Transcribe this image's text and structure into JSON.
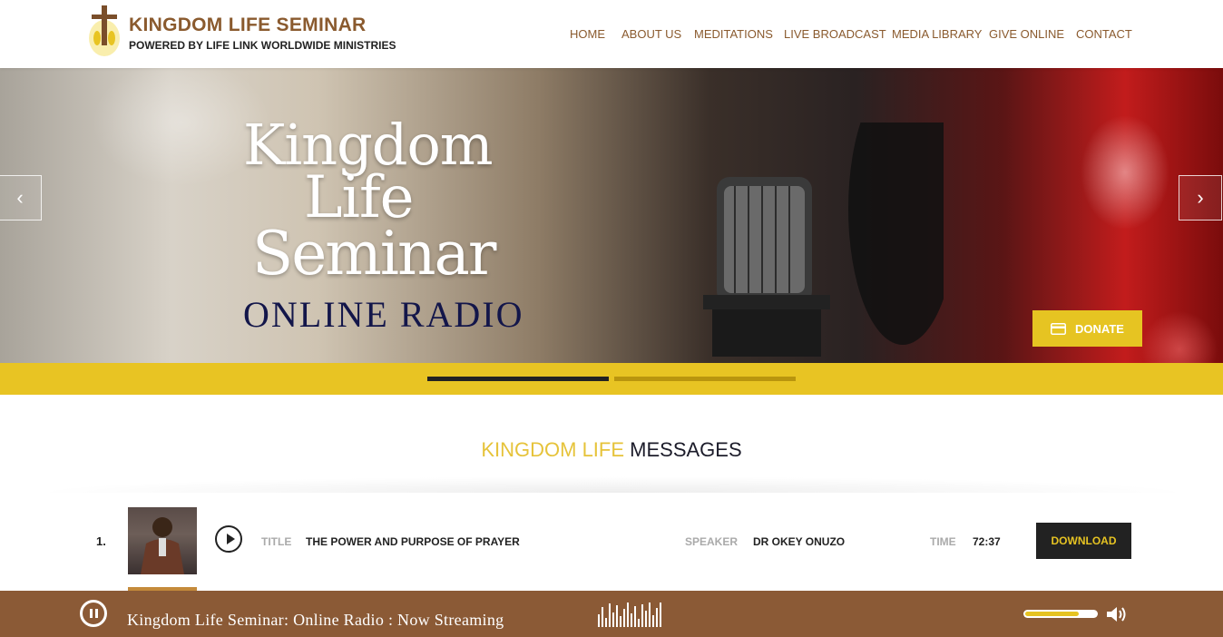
{
  "brand": {
    "title": "KINGDOM LIFE SEMINAR",
    "subtitle": "POWERED BY LIFE LINK WORLDWIDE MINISTRIES"
  },
  "nav": [
    {
      "label": "HOME"
    },
    {
      "label": "ABOUT US"
    },
    {
      "label": "MEDITATIONS"
    },
    {
      "label": "LIVE BROADCAST"
    },
    {
      "label": "MEDIA LIBRARY"
    },
    {
      "label": "GIVE ONLINE"
    },
    {
      "label": "CONTACT"
    }
  ],
  "hero": {
    "line1": "Kingdom",
    "line2": "Life",
    "line3": "Seminar",
    "subtitle": "ONLINE RADIO",
    "prev_arrow": "‹",
    "next_arrow": "›",
    "donate_label": "DONATE"
  },
  "section": {
    "title_accent": "KINGDOM LIFE",
    "title_main": "MESSAGES"
  },
  "tracks": [
    {
      "number": "1.",
      "title_label": "TITLE",
      "title": "THE POWER AND PURPOSE OF PRAYER",
      "speaker_label": "SPEAKER",
      "speaker": "DR OKEY ONUZO",
      "time_label": "TIME",
      "time": "72:37",
      "download_label": "DOWNLOAD"
    }
  ],
  "player": {
    "now_playing": "Kingdom Life Seminar: Online Radio : Now Streaming",
    "volume": 0.75
  },
  "colors": {
    "brown": "#8b5a36",
    "gold": "#e8c423",
    "dark": "#222222"
  }
}
